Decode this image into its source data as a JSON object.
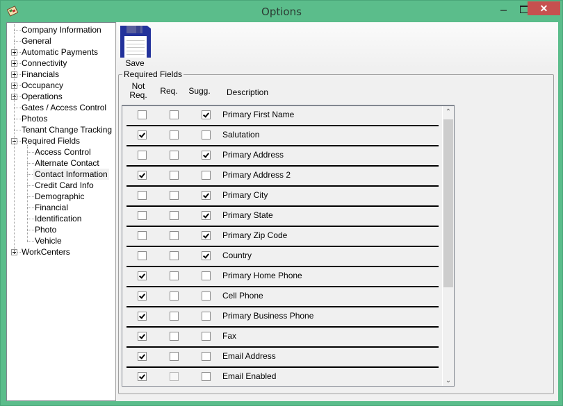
{
  "window": {
    "title": "Options",
    "close_glyph": "✕"
  },
  "tree": {
    "items": [
      {
        "label": "Company Information",
        "level": 0,
        "expander": "none"
      },
      {
        "label": "General",
        "level": 0,
        "expander": "none"
      },
      {
        "label": "Automatic Payments",
        "level": 0,
        "expander": "plus"
      },
      {
        "label": "Connectivity",
        "level": 0,
        "expander": "plus"
      },
      {
        "label": "Financials",
        "level": 0,
        "expander": "plus"
      },
      {
        "label": "Occupancy",
        "level": 0,
        "expander": "plus"
      },
      {
        "label": "Operations",
        "level": 0,
        "expander": "plus"
      },
      {
        "label": "Gates / Access Control",
        "level": 0,
        "expander": "none"
      },
      {
        "label": "Photos",
        "level": 0,
        "expander": "none"
      },
      {
        "label": "Tenant Change Tracking",
        "level": 0,
        "expander": "none"
      },
      {
        "label": "Required Fields",
        "level": 0,
        "expander": "minus"
      },
      {
        "label": "Access Control",
        "level": 1,
        "expander": "none"
      },
      {
        "label": "Alternate Contact",
        "level": 1,
        "expander": "none"
      },
      {
        "label": "Contact Information",
        "level": 1,
        "expander": "none",
        "selected": true
      },
      {
        "label": "Credit Card Info",
        "level": 1,
        "expander": "none"
      },
      {
        "label": "Demographic",
        "level": 1,
        "expander": "none"
      },
      {
        "label": "Financial",
        "level": 1,
        "expander": "none"
      },
      {
        "label": "Identification",
        "level": 1,
        "expander": "none"
      },
      {
        "label": "Photo",
        "level": 1,
        "expander": "none"
      },
      {
        "label": "Vehicle",
        "level": 1,
        "expander": "none"
      },
      {
        "label": "WorkCenters",
        "level": 0,
        "expander": "plus"
      }
    ]
  },
  "toolbar": {
    "save_label": "Save"
  },
  "required_fields": {
    "group_title": "Required Fields",
    "columns": {
      "not_req_line1": "Not",
      "not_req_line2": "Req.",
      "req": "Req.",
      "sugg": "Sugg.",
      "description": "Description"
    },
    "rows": [
      {
        "description": "Primary First Name",
        "not_req": false,
        "req": false,
        "sugg": true
      },
      {
        "description": "Salutation",
        "not_req": true,
        "req": false,
        "sugg": false
      },
      {
        "description": "Primary Address",
        "not_req": false,
        "req": false,
        "sugg": true
      },
      {
        "description": "Primary Address 2",
        "not_req": true,
        "req": false,
        "sugg": false
      },
      {
        "description": "Primary City",
        "not_req": false,
        "req": false,
        "sugg": true
      },
      {
        "description": "Primary State",
        "not_req": false,
        "req": false,
        "sugg": true
      },
      {
        "description": "Primary Zip Code",
        "not_req": false,
        "req": false,
        "sugg": true
      },
      {
        "description": "Country",
        "not_req": false,
        "req": false,
        "sugg": true
      },
      {
        "description": "Primary Home Phone",
        "not_req": true,
        "req": false,
        "sugg": false
      },
      {
        "description": "Cell Phone",
        "not_req": true,
        "req": false,
        "sugg": false
      },
      {
        "description": "Primary Business Phone",
        "not_req": true,
        "req": false,
        "sugg": false
      },
      {
        "description": "Fax",
        "not_req": true,
        "req": false,
        "sugg": false
      },
      {
        "description": "Email Address",
        "not_req": true,
        "req": false,
        "sugg": false
      },
      {
        "description": "Email Enabled",
        "not_req": true,
        "req": false,
        "sugg": false,
        "req_disabled": true
      }
    ]
  },
  "scrollbar": {
    "up_glyph": "⌃",
    "down_glyph": "⌄",
    "position_fraction": 0
  }
}
